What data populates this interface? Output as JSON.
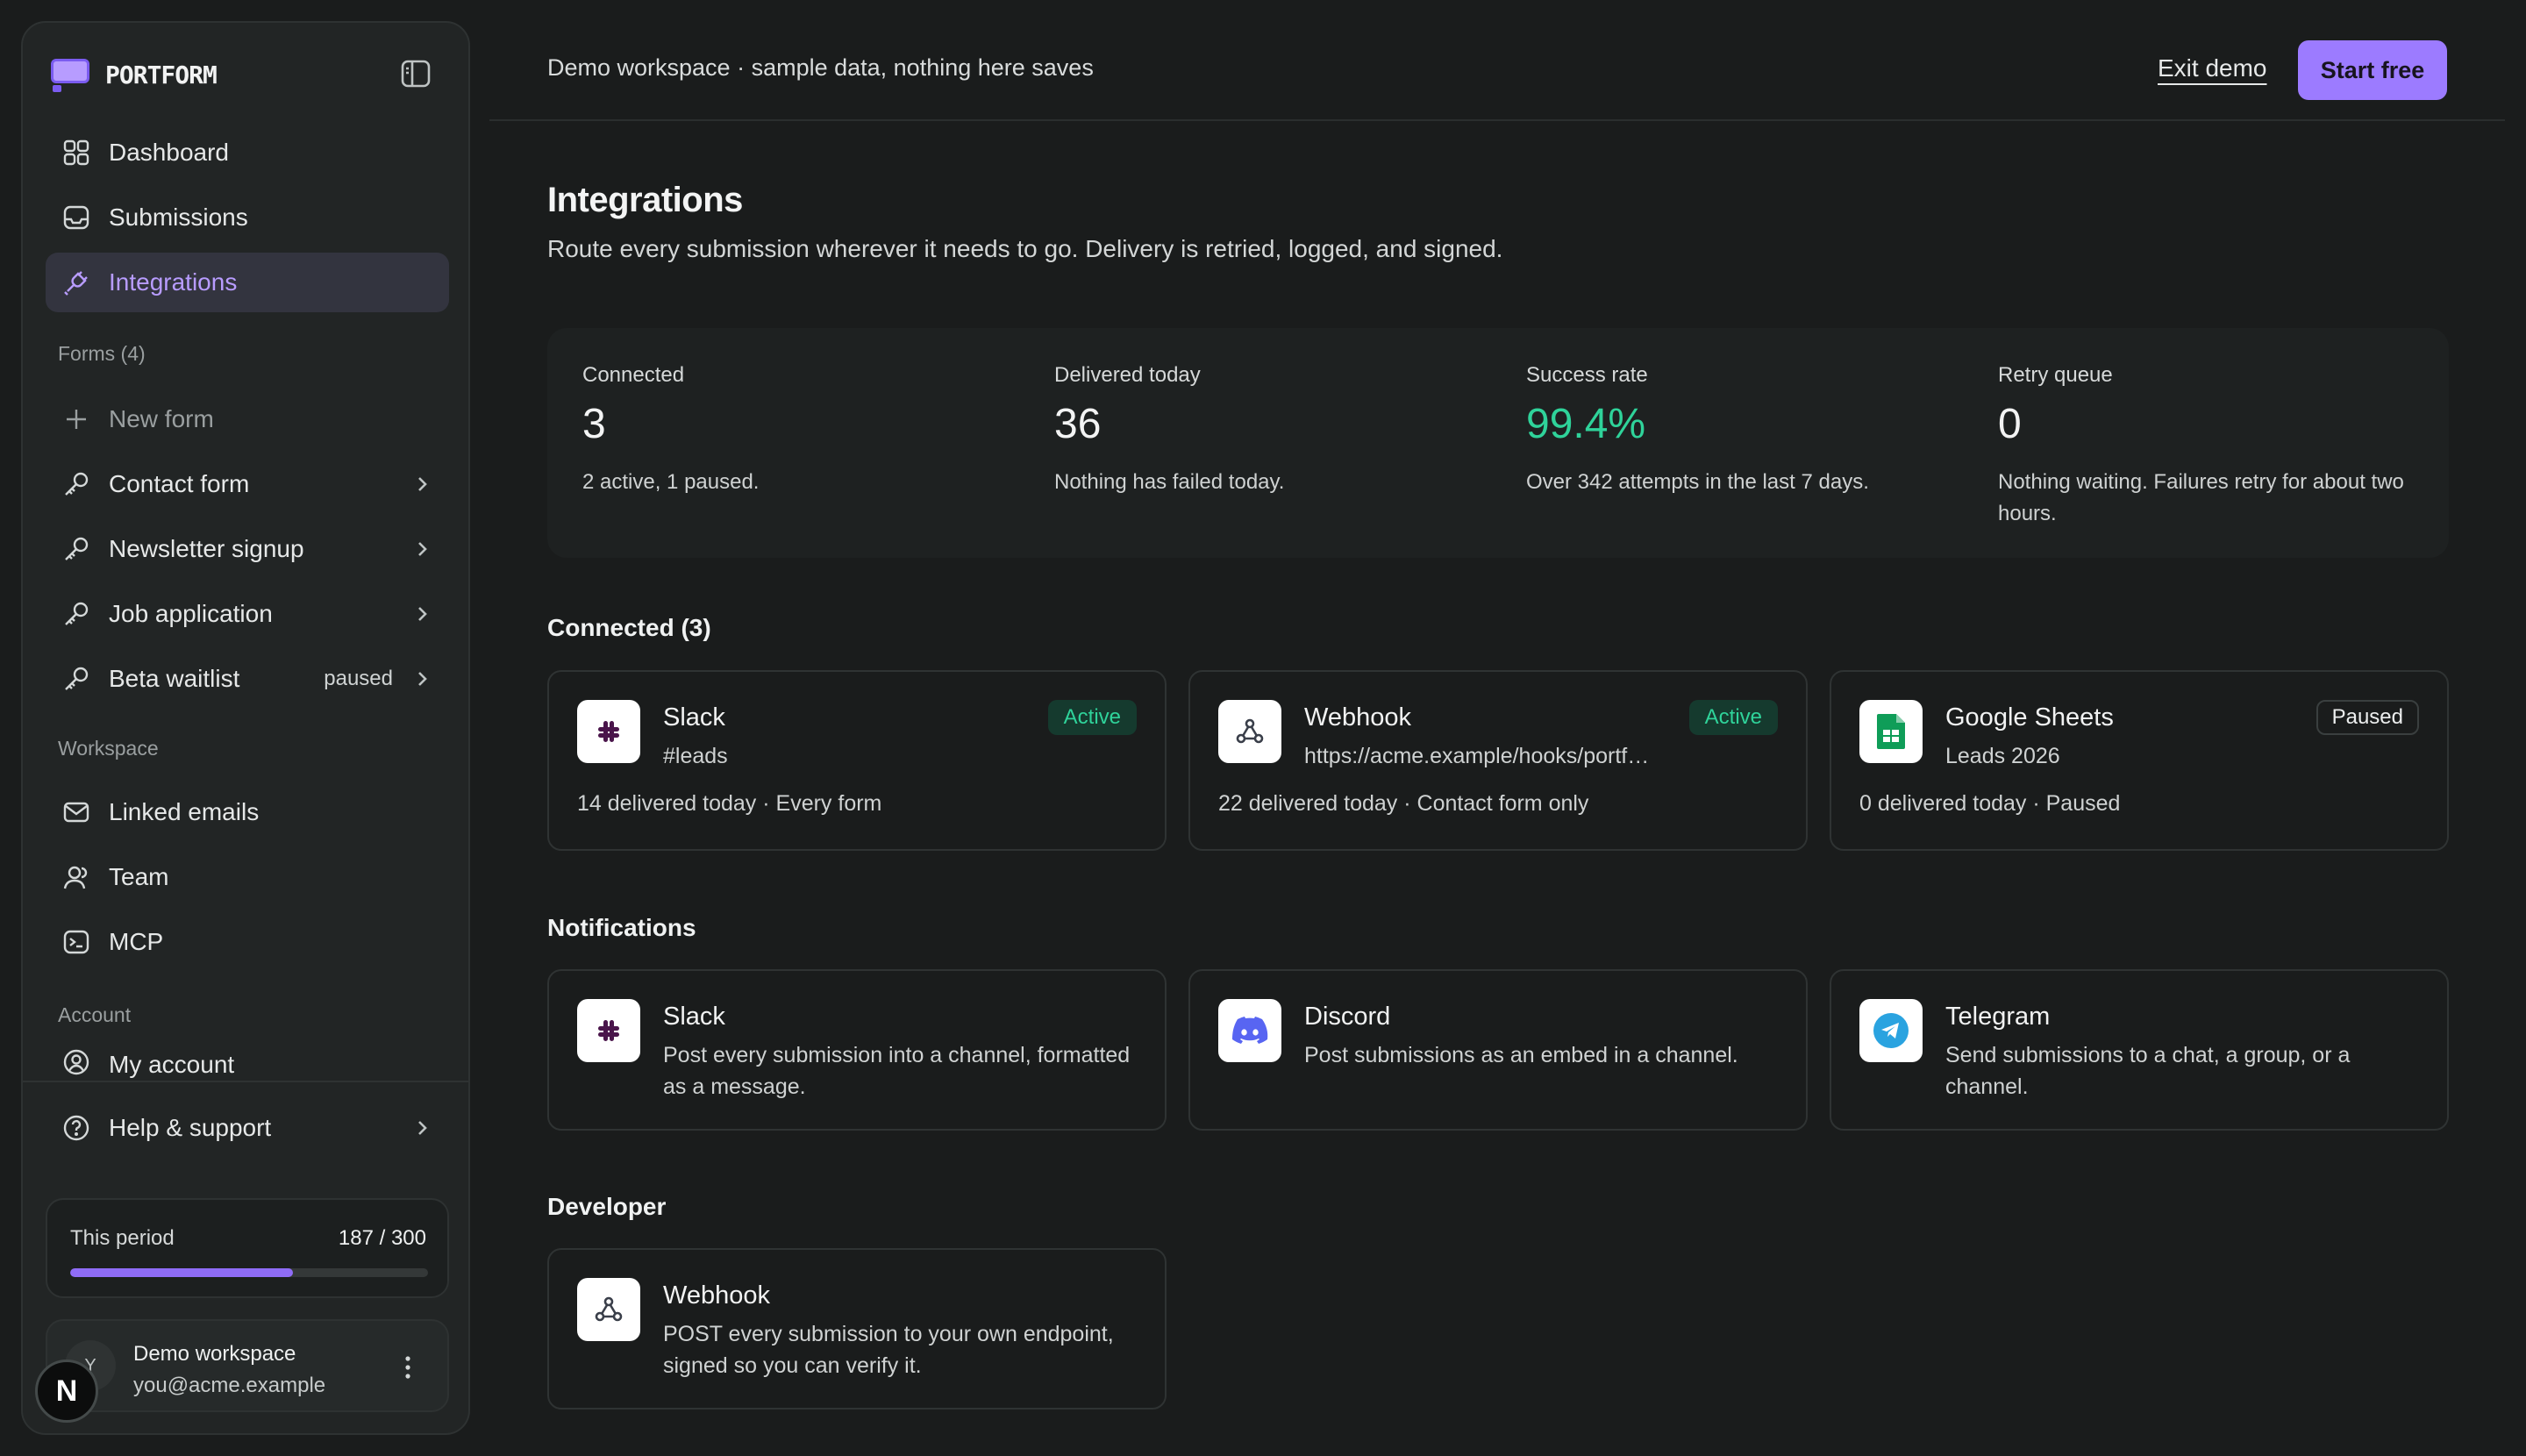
{
  "brand": {
    "name": "PORTFORM"
  },
  "nav": {
    "dashboard": "Dashboard",
    "submissions": "Submissions",
    "integrations": "Integrations"
  },
  "forms": {
    "label": "Forms (4)",
    "new_form": "New form",
    "items": [
      {
        "label": "Contact form"
      },
      {
        "label": "Newsletter signup"
      },
      {
        "label": "Job application"
      },
      {
        "label": "Beta waitlist",
        "tag": "paused"
      }
    ]
  },
  "workspace": {
    "label": "Workspace",
    "linked_emails": "Linked emails",
    "team": "Team",
    "mcp": "MCP"
  },
  "account_section": {
    "label": "Account",
    "my_account": "My account",
    "help": "Help & support"
  },
  "usage": {
    "label": "This period",
    "value": "187 / 300",
    "fraction": 0.623
  },
  "account": {
    "initial": "Y",
    "name": "Demo workspace",
    "email": "you@acme.example"
  },
  "badge": {
    "letter": "N"
  },
  "topbar": {
    "text": "Demo workspace · sample data, nothing here saves",
    "exit": "Exit demo",
    "start": "Start free"
  },
  "page": {
    "title": "Integrations",
    "subtitle": "Route every submission wherever it needs to go. Delivery is retried, logged, and signed."
  },
  "stats": [
    {
      "label": "Connected",
      "value": "3",
      "note": "2 active, 1 paused."
    },
    {
      "label": "Delivered today",
      "value": "36",
      "note": "Nothing has failed today."
    },
    {
      "label": "Success rate",
      "value": "99.4%",
      "note": "Over 342 attempts in the last 7 days."
    },
    {
      "label": "Retry queue",
      "value": "0",
      "note": "Nothing waiting. Failures retry for about two hours."
    }
  ],
  "connected": {
    "heading": "Connected (3)",
    "cards": [
      {
        "title": "Slack",
        "sub": "#leads",
        "foot": "14 delivered today · Every form",
        "status": "Active",
        "icon": "slack-icon"
      },
      {
        "title": "Webhook",
        "sub": "https://acme.example/hooks/portform",
        "foot": "22 delivered today · Contact form only",
        "status": "Active",
        "icon": "webhook-icon"
      },
      {
        "title": "Google Sheets",
        "sub": "Leads 2026",
        "foot": "0 delivered today · Paused",
        "status": "Paused",
        "icon": "google-sheets-icon"
      }
    ]
  },
  "notifications": {
    "heading": "Notifications",
    "cards": [
      {
        "title": "Slack",
        "sub": "Post every submission into a channel, formatted as a message.",
        "icon": "slack-icon"
      },
      {
        "title": "Discord",
        "sub": "Post submissions as an embed in a channel.",
        "icon": "discord-icon"
      },
      {
        "title": "Telegram",
        "sub": "Send submissions to a chat, a group, or a channel.",
        "icon": "telegram-icon"
      }
    ]
  },
  "developer": {
    "heading": "Developer",
    "cards": [
      {
        "title": "Webhook",
        "sub": "POST every submission to your own endpoint, signed so you can verify it.",
        "icon": "webhook-icon"
      }
    ]
  },
  "colors": {
    "accent": "#9c7bff",
    "success": "#2fd39a",
    "background": "#1a1c1c"
  }
}
